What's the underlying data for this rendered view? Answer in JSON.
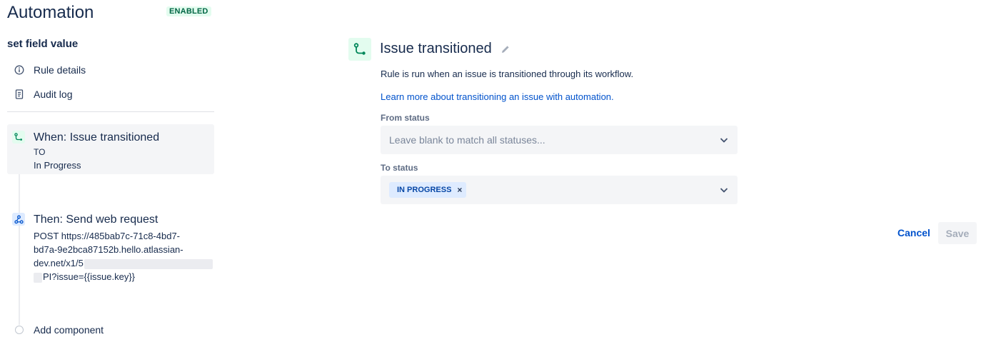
{
  "header": {
    "title": "Automation",
    "status_badge": "ENABLED",
    "rule_name": "set field value"
  },
  "nav": {
    "rule_details": "Rule details",
    "audit_log": "Audit log"
  },
  "flow": {
    "trigger": {
      "title": "When: Issue transitioned",
      "line1": "TO",
      "line2": "In Progress"
    },
    "action": {
      "title": "Then: Send web request",
      "line1": "POST https://485bab7c-71c8-4bd7-",
      "line2": "bd7a-9e2bca87152b.hello.atlassian-",
      "line3_prefix": "dev.net/x1/5",
      "line4_suffix": "PI?issue={{issue.key}}"
    },
    "add_component": "Add component"
  },
  "panel": {
    "title": "Issue transitioned",
    "description": "Rule is run when an issue is transitioned through its workflow.",
    "learn_more": "Learn more about transitioning an issue with automation.",
    "from_status": {
      "label": "From status",
      "placeholder": "Leave blank to match all statuses..."
    },
    "to_status": {
      "label": "To status",
      "chips": [
        "IN PROGRESS"
      ],
      "chip_remove": "×"
    },
    "cancel_label": "Cancel",
    "save_label": "Save"
  },
  "colors": {
    "enabled_bg": "#e3fcef",
    "enabled_text": "#006644",
    "link": "#0052cc",
    "chip_bg": "#deebff",
    "field_bg": "#f4f5f7"
  }
}
